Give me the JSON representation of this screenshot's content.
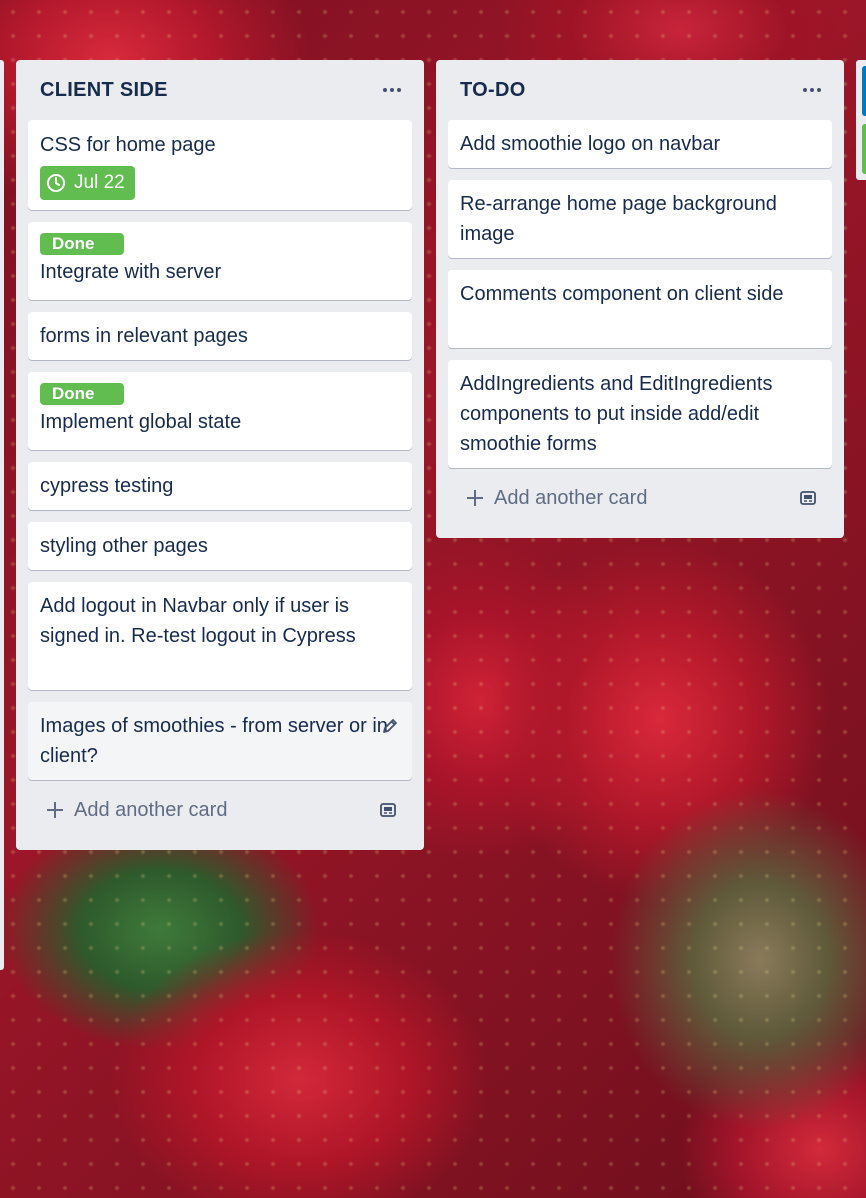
{
  "lists": [
    {
      "title": "CLIENT SIDE",
      "cards": [
        {
          "text": "CSS for home page",
          "due": "Jul 22"
        },
        {
          "label": "Done",
          "text": "Integrate with server"
        },
        {
          "text": "forms in relevant pages"
        },
        {
          "label": "Done",
          "text": "Implement global state"
        },
        {
          "text": "cypress testing"
        },
        {
          "text": "styling other pages"
        },
        {
          "text": "Add logout in Navbar only if user is signed in. Re-test logout in Cypress"
        },
        {
          "text": "Images of smoothies - from server or in client?"
        }
      ],
      "add_card_label": "Add another card"
    },
    {
      "title": "TO-DO",
      "cards": [
        {
          "text": "Add smoothie logo on navbar"
        },
        {
          "text": "Re-arrange home page background image"
        },
        {
          "text": "Comments component on client side"
        },
        {
          "text": "AddIngredients and EditIngredients components to put inside add/edit smoothie forms"
        }
      ],
      "add_card_label": "Add another card"
    }
  ],
  "colors": {
    "list_bg": "#ebecf0",
    "label_green": "#61bd4f",
    "text": "#172b4d",
    "muted": "#5e6c84"
  },
  "icons": [
    "menu-dots-icon",
    "clock-icon",
    "pencil-icon",
    "plus-icon",
    "card-template-icon"
  ]
}
